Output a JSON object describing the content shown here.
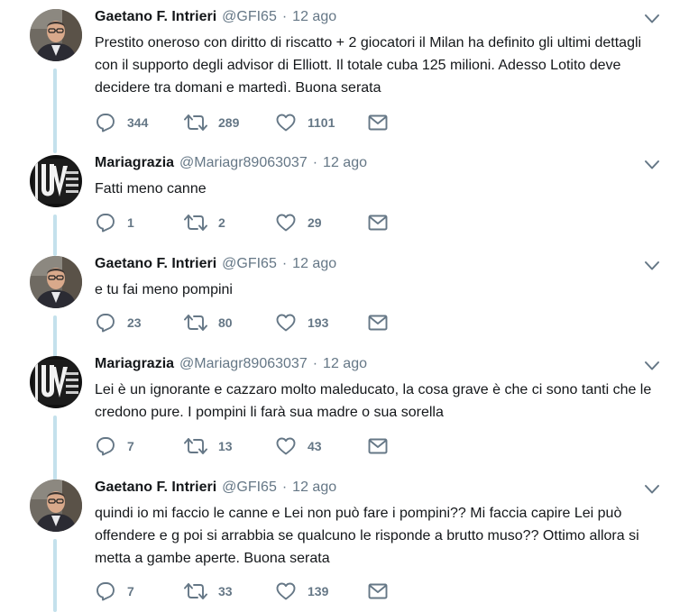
{
  "colors": {
    "thread_line": "#c4e1ec",
    "icon": "#657786",
    "text": "#14171a"
  },
  "tweets": [
    {
      "name": "Gaetano F. Intrieri",
      "handle": "@GFI65",
      "separator": "·",
      "time": "12 ago",
      "text": "Prestito oneroso con diritto di riscatto + 2 giocatori il Milan ha definito gli ultimi dettagli con il supporto degli advisor di Elliott. Il totale cuba 125 milioni. Adesso Lotito deve decidere tra domani e martedì. Buona serata",
      "replies": "344",
      "retweets": "289",
      "likes": "1101",
      "avatar": "man-with-glasses"
    },
    {
      "name": "Mariagrazia",
      "handle": "@Mariagr89063037",
      "separator": "·",
      "time": "12 ago",
      "text": "Fatti meno canne",
      "replies": "1",
      "retweets": "2",
      "likes": "29",
      "avatar": "juventus-logo"
    },
    {
      "name": "Gaetano F. Intrieri",
      "handle": "@GFI65",
      "separator": "·",
      "time": "12 ago",
      "text": "e tu fai meno pompini",
      "replies": "23",
      "retweets": "80",
      "likes": "193",
      "avatar": "man-with-glasses"
    },
    {
      "name": "Mariagrazia",
      "handle": "@Mariagr89063037",
      "separator": "·",
      "time": "12 ago",
      "text": "Lei è un ignorante e cazzaro molto maleducato, la cosa grave è che ci sono tanti che le credono pure. I pompini li farà sua madre o sua sorella",
      "replies": "7",
      "retweets": "13",
      "likes": "43",
      "avatar": "juventus-logo"
    },
    {
      "name": "Gaetano F. Intrieri",
      "handle": "@GFI65",
      "separator": "·",
      "time": "12 ago",
      "text": "quindi io mi faccio le canne e Lei non può fare i pompini?? Mi faccia capire Lei può offendere e g poi si arrabbia se qualcuno le risponde a brutto muso?? Ottimo allora si metta a gambe aperte. Buona serata",
      "replies": "7",
      "retweets": "33",
      "likes": "139",
      "avatar": "man-with-glasses"
    }
  ]
}
